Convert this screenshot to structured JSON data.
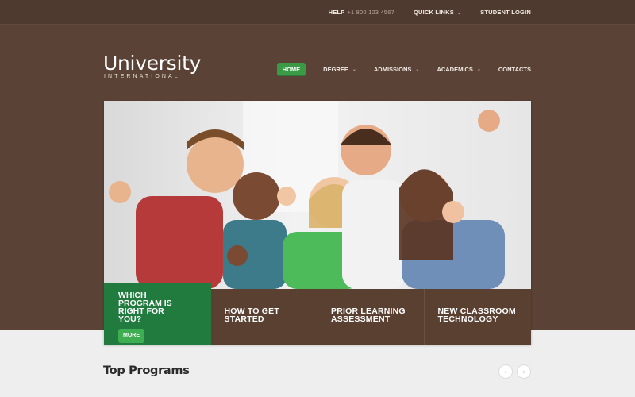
{
  "topbar": {
    "help_label": "HELP",
    "help_phone": "+1 800 123 4567",
    "quick_links": "QUICK LINKS",
    "student_login": "STUDENT LOGIN"
  },
  "logo": {
    "main": "University",
    "sub": "INTERNATIONAL"
  },
  "nav": {
    "items": [
      {
        "label": "HOME",
        "active": true
      },
      {
        "label": "DEGREE",
        "dropdown": true
      },
      {
        "label": "ADMISSIONS",
        "dropdown": true
      },
      {
        "label": "ACADEMICS",
        "dropdown": true
      },
      {
        "label": "CONTACTS"
      }
    ]
  },
  "hero": {
    "feature": {
      "text": "WHICH PROGRAM IS RIGHT FOR YOU?",
      "button": "MORE"
    },
    "boxes": [
      "HOW TO GET STARTED",
      "PRIOR LEARNING ASSESSMENT",
      "NEW CLASSROOM TECHNOLOGY"
    ]
  },
  "section": {
    "title": "Top Programs",
    "prev_icon": "chevron-left-icon",
    "next_icon": "chevron-right-icon"
  },
  "colors": {
    "brown_dark": "#4e3a2e",
    "brown": "#5a4336",
    "green_accent": "#3a9a46",
    "green_box": "#217a3e"
  }
}
